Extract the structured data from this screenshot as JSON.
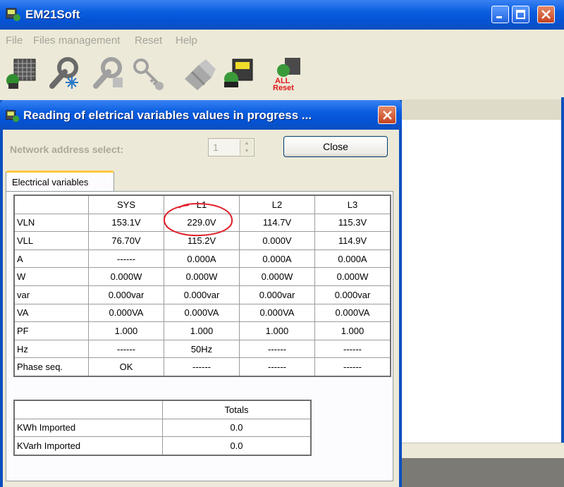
{
  "app": {
    "title": "EM21Soft"
  },
  "menu": [
    "File",
    "Files management",
    "Reset",
    "Help"
  ],
  "toolbar": {
    "icons": [
      "meter-grid-icon",
      "wrench-snowflake-icon",
      "wrench-settings-icon",
      "key-icon",
      "eraser-icon",
      "meter-reading-icon",
      "all-reset-icon"
    ],
    "reset_label_1": "ALL",
    "reset_label_2": "Reset"
  },
  "dialog": {
    "title": "Reading of eletrical variables values in progress ...",
    "network_label": "Network address select:",
    "network_value": "1",
    "close_label": "Close",
    "tab_label": "Electrical variables"
  },
  "variables": {
    "columns": [
      "",
      "SYS",
      "L1",
      "L2",
      "L3"
    ],
    "rows": [
      [
        "VLN",
        "153.1V",
        "229.0V",
        "114.7V",
        "115.3V"
      ],
      [
        "VLL",
        "76.70V",
        "115.2V",
        "0.000V",
        "114.9V"
      ],
      [
        "A",
        "------",
        "0.000A",
        "0.000A",
        "0.000A"
      ],
      [
        "W",
        "0.000W",
        "0.000W",
        "0.000W",
        "0.000W"
      ],
      [
        "var",
        "0.000var",
        "0.000var",
        "0.000var",
        "0.000var"
      ],
      [
        "VA",
        "0.000VA",
        "0.000VA",
        "0.000VA",
        "0.000VA"
      ],
      [
        "PF",
        "1.000",
        "1.000",
        "1.000",
        "1.000"
      ],
      [
        "Hz",
        "------",
        "50Hz",
        "------",
        "------"
      ],
      [
        "Phase seq.",
        "OK",
        "------",
        "------",
        "------"
      ]
    ]
  },
  "totals": {
    "columns": [
      "",
      "Totals"
    ],
    "rows": [
      [
        "KWh Imported",
        "0.0"
      ],
      [
        "KVarh Imported",
        "0.0"
      ]
    ]
  },
  "colors": {
    "titlebar": "#0553d4",
    "highlight_circle": "#e0202a"
  }
}
